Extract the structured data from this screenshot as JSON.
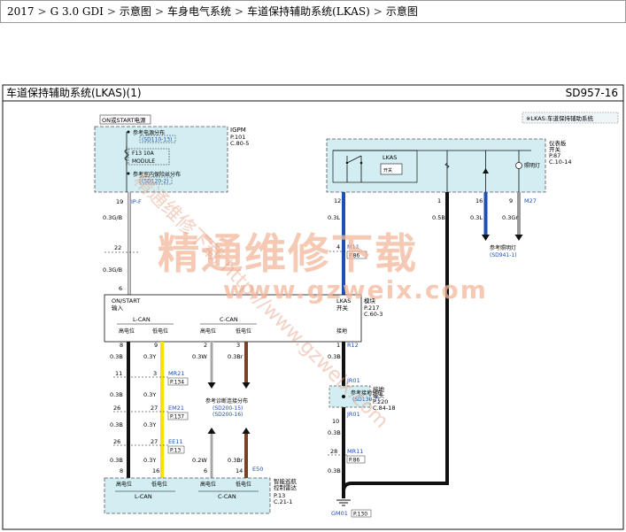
{
  "breadcrumb": [
    "2017",
    "G 3.0 GDI",
    "示意图",
    "车身电气系统",
    "车道保持辅助系统(LKAS)",
    "示意图"
  ],
  "breadcrumb_sep": ">",
  "header": {
    "title": "车道保持辅助系统(LKAS)(1)",
    "code": "SD957-16"
  },
  "legend": "※LKAS:车道保持辅助系统",
  "power": {
    "label": "ON或START电源"
  },
  "ipgm": {
    "name": "IGPM",
    "ref1": "P.101",
    "ref2": "C.80-5",
    "ref_label_1": "参考电源分布",
    "ref_code_1": "(SD110-13)",
    "fuse": "F13 10A",
    "module": "MODULE",
    "ref_label_2": "参考室内保险丝分布",
    "ref_code_2": "(SD120-2)",
    "pin": "19",
    "wire_code": "IP-F"
  },
  "panel": {
    "name": "仪表板",
    "name2": "开关",
    "ref1": "P.87",
    "ref2": "C.10-14",
    "lkas": "LKAS",
    "lkas_sub": "开关",
    "lamp": "照明灯",
    "pins": [
      "12",
      "1",
      "16",
      "9"
    ],
    "wire_code": "M27",
    "lamp_ref": "参考照明灯",
    "lamp_ref_code": "(SD941-1)"
  },
  "wires": {
    "w1": "0.3G/B",
    "w2": "0.3G/B",
    "w3": "0.3L",
    "w4": "0.5B",
    "w5": "0.3L",
    "w6": "0.3Gr",
    "w7": "0.3L",
    "can_hi_1": "0.3B",
    "can_lo_1": "0.3Y",
    "can_c_hi": "0.3W",
    "can_c_lo": "0.3Br",
    "gnd_1": "0.3B",
    "gnd_2": "0.3B",
    "gnd_3": "0.3B",
    "bot_c_hi": "0.2W",
    "bot_c_lo": "0.3Br"
  },
  "connectors": {
    "j22": "22",
    "ja": "4",
    "jm": "M11",
    "jm_ref": "P.86",
    "j6": "6"
  },
  "lkas_module": {
    "left1": "ON/START",
    "left2": "输入",
    "right1": "LKAS",
    "right2": "模块",
    "right_sub": "开关",
    "ref1": "P.217",
    "ref2": "C.60-3",
    "lcan": "L-CAN",
    "ccan": "C-CAN",
    "hi": "高电位",
    "lo": "低电位",
    "gnd": "接地",
    "pins": [
      "8",
      "9",
      "2",
      "3",
      "1"
    ],
    "gnd_code": "R12"
  },
  "mr21": {
    "name": "MR21",
    "ref": "P.134",
    "pins": [
      "11",
      "3"
    ]
  },
  "em21": {
    "name": "EM21",
    "ref": "P.137",
    "pins": [
      "26",
      "27"
    ]
  },
  "ee11": {
    "name": "EE11",
    "ref": "P.13",
    "pins": [
      "26",
      "27"
    ]
  },
  "can_ref": {
    "label": "参考诊断连接分布",
    "code1": "(SD200-15)",
    "code2": "(SD200-16)"
  },
  "splice": {
    "jr01": "JR01",
    "name": "接地",
    "name2": "接头",
    "ref1": "P.220",
    "ref2": "C.84-18",
    "ref_label": "参考接地分布",
    "ref_code": "(SD130-7)",
    "jr01b": "JR01",
    "pin": "10"
  },
  "mr11": {
    "pin": "28",
    "name": "MR11",
    "ref": "P.86"
  },
  "bottom": {
    "pins": [
      "8",
      "16",
      "6",
      "14"
    ],
    "lcan": "L-CAN",
    "ccan": "C-CAN",
    "hi": "高电位",
    "lo": "低电位",
    "name": "智能巡航",
    "name2": "控制雷达",
    "ref1": "P.13",
    "ref2": "C.21-1",
    "e50": "E50"
  },
  "ground": {
    "name": "GM01",
    "ref": "P.130"
  },
  "watermark": {
    "big": "精通维修下载",
    "url": "www.gzweix.com",
    "diag": "精通维修下载 http://www.gzweix.com"
  },
  "colors": {
    "yellow": "#f5e400",
    "blue": "#1e4fb4",
    "brown": "#7b3f22",
    "gray": "#9a9a9a",
    "black": "#111111",
    "box_fill": "#d2eef2",
    "watermark": "#f1b79a"
  }
}
